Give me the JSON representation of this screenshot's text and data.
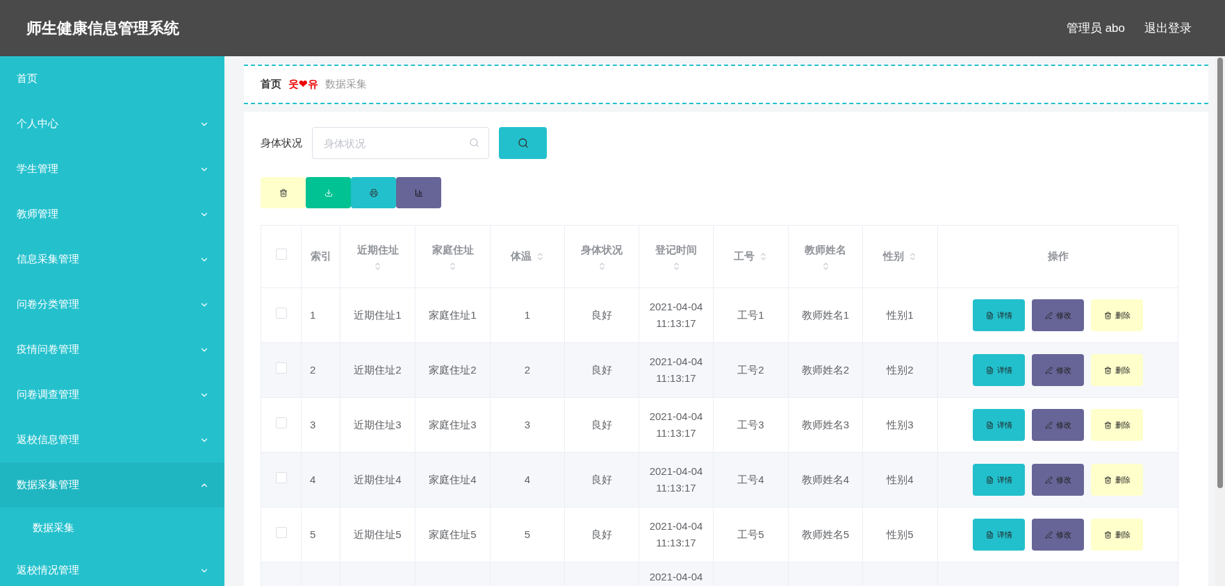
{
  "header": {
    "title": "师生健康信息管理系统",
    "user": "管理员 abo",
    "logout": "退出登录"
  },
  "sidebar": {
    "items": [
      {
        "label": "首页",
        "kind": "link"
      },
      {
        "label": "个人中心",
        "kind": "menu",
        "expanded": false
      },
      {
        "label": "学生管理",
        "kind": "menu",
        "expanded": false
      },
      {
        "label": "教师管理",
        "kind": "menu",
        "expanded": false
      },
      {
        "label": "信息采集管理",
        "kind": "menu",
        "expanded": false
      },
      {
        "label": "问卷分类管理",
        "kind": "menu",
        "expanded": false
      },
      {
        "label": "疫情问卷管理",
        "kind": "menu",
        "expanded": false
      },
      {
        "label": "问卷调查管理",
        "kind": "menu",
        "expanded": false
      },
      {
        "label": "返校信息管理",
        "kind": "menu",
        "expanded": false
      },
      {
        "label": "数据采集管理",
        "kind": "menu",
        "expanded": true,
        "children": [
          {
            "label": "数据采集"
          }
        ]
      },
      {
        "label": "返校情况管理",
        "kind": "menu",
        "expanded": false
      }
    ]
  },
  "breadcrumb": {
    "home": "首页",
    "separator": "웃❤유",
    "current": "数据采集"
  },
  "search": {
    "label": "身体状况",
    "placeholder": "身体状况"
  },
  "toolbar": [
    {
      "kind": "delete"
    },
    {
      "kind": "export"
    },
    {
      "kind": "print"
    },
    {
      "kind": "chart"
    }
  ],
  "table": {
    "all_checked": false,
    "columns": [
      {
        "label": "索引",
        "sortable": false
      },
      {
        "label": "近期住址",
        "sortable": true
      },
      {
        "label": "家庭住址",
        "sortable": true
      },
      {
        "label": "体温",
        "sortable": true
      },
      {
        "label": "身体状况",
        "sortable": true
      },
      {
        "label": "登记时间",
        "sortable": true
      },
      {
        "label": "工号",
        "sortable": true
      },
      {
        "label": "教师姓名",
        "sortable": true
      },
      {
        "label": "性别",
        "sortable": true
      },
      {
        "label": "操作",
        "sortable": false
      }
    ],
    "rows": [
      {
        "checked": false,
        "cells": [
          "1",
          "近期住址1",
          "家庭住址1",
          "1",
          "良好",
          "2021-04-04 11:13:17",
          "工号1",
          "教师姓名1",
          "性别1"
        ],
        "actions": [
          {
            "kind": "detail",
            "label": "详情"
          },
          {
            "kind": "edit",
            "label": "修改"
          },
          {
            "kind": "delete",
            "label": "删除"
          }
        ]
      },
      {
        "checked": false,
        "cells": [
          "2",
          "近期住址2",
          "家庭住址2",
          "2",
          "良好",
          "2021-04-04 11:13:17",
          "工号2",
          "教师姓名2",
          "性别2"
        ],
        "actions": [
          {
            "kind": "detail",
            "label": "详情"
          },
          {
            "kind": "edit",
            "label": "修改"
          },
          {
            "kind": "delete",
            "label": "删除"
          }
        ]
      },
      {
        "checked": false,
        "cells": [
          "3",
          "近期住址3",
          "家庭住址3",
          "3",
          "良好",
          "2021-04-04 11:13:17",
          "工号3",
          "教师姓名3",
          "性别3"
        ],
        "actions": [
          {
            "kind": "detail",
            "label": "详情"
          },
          {
            "kind": "edit",
            "label": "修改"
          },
          {
            "kind": "delete",
            "label": "删除"
          }
        ]
      },
      {
        "checked": false,
        "cells": [
          "4",
          "近期住址4",
          "家庭住址4",
          "4",
          "良好",
          "2021-04-04 11:13:17",
          "工号4",
          "教师姓名4",
          "性别4"
        ],
        "actions": [
          {
            "kind": "detail",
            "label": "详情"
          },
          {
            "kind": "edit",
            "label": "修改"
          },
          {
            "kind": "delete",
            "label": "删除"
          }
        ]
      },
      {
        "checked": false,
        "cells": [
          "5",
          "近期住址5",
          "家庭住址5",
          "5",
          "良好",
          "2021-04-04 11:13:17",
          "工号5",
          "教师姓名5",
          "性别5"
        ],
        "actions": [
          {
            "kind": "detail",
            "label": "详情"
          },
          {
            "kind": "edit",
            "label": "修改"
          },
          {
            "kind": "delete",
            "label": "删除"
          }
        ]
      }
    ],
    "partial_row": {
      "date": "2021-04-04"
    }
  }
}
